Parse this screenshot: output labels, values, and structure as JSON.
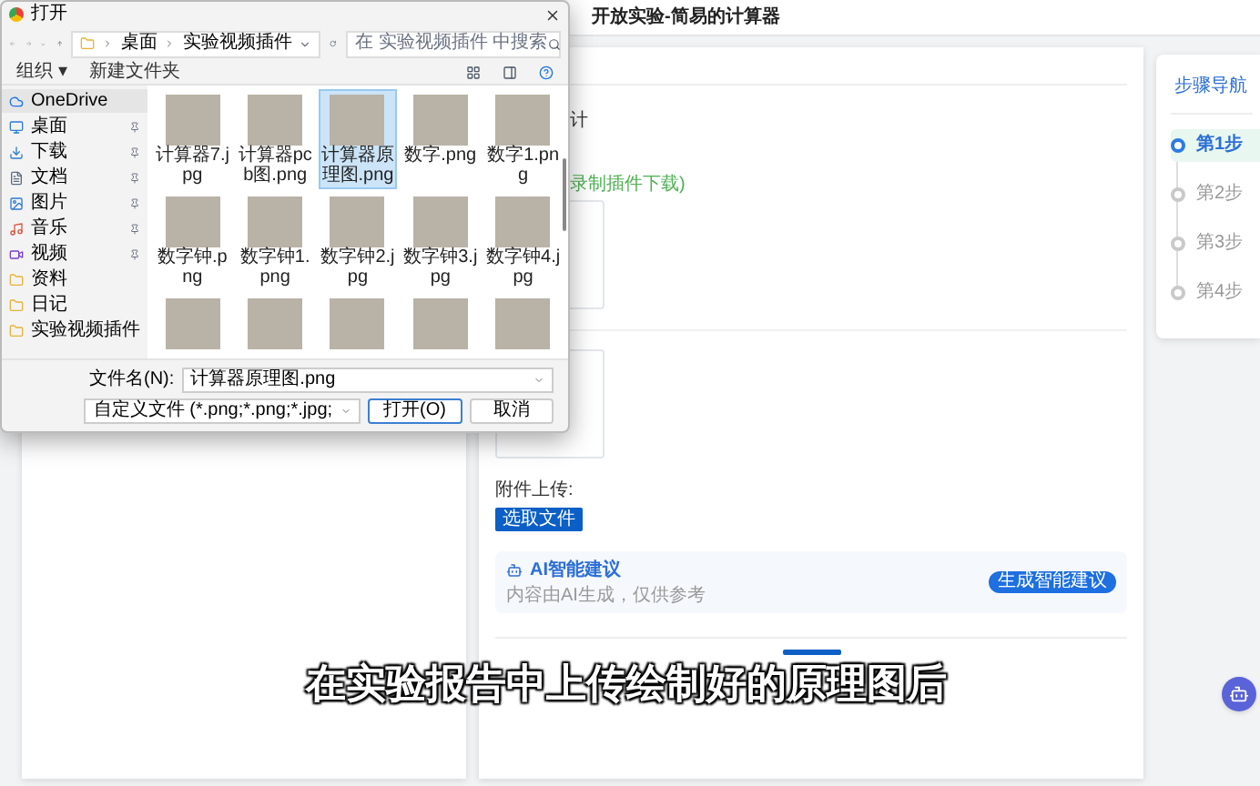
{
  "page": {
    "title": "开放实验-简易的计算器",
    "section_title": "计",
    "note": "录制插件下载)",
    "attachment_label": "附件上传:",
    "choose_file_button": "选取文件",
    "ai": {
      "title": "AI智能建议",
      "subtitle": "内容由AI生成，仅供参考",
      "button": "生成智能建议"
    }
  },
  "steps": {
    "title": "步骤导航",
    "items": [
      {
        "label": "第1步",
        "selected": true
      },
      {
        "label": "第2步",
        "selected": false
      },
      {
        "label": "第3步",
        "selected": false
      },
      {
        "label": "第4步",
        "selected": false
      }
    ]
  },
  "dialog": {
    "title": "打开",
    "breadcrumb": [
      "桌面",
      "实验视频插件"
    ],
    "search": {
      "placeholder": "在 实验视频插件 中搜索"
    },
    "organize": "组织 ▾",
    "new_folder": "新建文件夹",
    "sidebar": [
      {
        "label": "OneDrive",
        "kind": "cloud",
        "pinned": false,
        "selected": true
      },
      {
        "label": "桌面",
        "kind": "desktop",
        "pinned": true,
        "selected": false
      },
      {
        "label": "下载",
        "kind": "download",
        "pinned": true,
        "selected": false
      },
      {
        "label": "文档",
        "kind": "document",
        "pinned": true,
        "selected": false
      },
      {
        "label": "图片",
        "kind": "picture",
        "pinned": true,
        "selected": false
      },
      {
        "label": "音乐",
        "kind": "music",
        "pinned": true,
        "selected": false
      },
      {
        "label": "视频",
        "kind": "video",
        "pinned": true,
        "selected": false
      },
      {
        "label": "资料",
        "kind": "folder",
        "pinned": false,
        "selected": false
      },
      {
        "label": "日记",
        "kind": "folder",
        "pinned": false,
        "selected": false
      },
      {
        "label": "实验视频插件",
        "kind": "folder",
        "pinned": false,
        "selected": false
      }
    ],
    "files": [
      {
        "name": "计算器7.jpg",
        "selected": false
      },
      {
        "name": "计算器pcb图.png",
        "selected": false
      },
      {
        "name": "计算器原理图.png",
        "selected": true
      },
      {
        "name": "数字.png",
        "selected": false
      },
      {
        "name": "数字1.png",
        "selected": false
      },
      {
        "name": "数字钟.png",
        "selected": false
      },
      {
        "name": "数字钟1.png",
        "selected": false
      },
      {
        "name": "数字钟2.jpg",
        "selected": false
      },
      {
        "name": "数字钟3.jpg",
        "selected": false
      },
      {
        "name": "数字钟4.jpg",
        "selected": false
      },
      {
        "selected": false
      },
      {
        "selected": false
      },
      {
        "selected": false
      },
      {
        "selected": false
      },
      {
        "selected": false
      }
    ],
    "filename_label": "文件名(N):",
    "filename": "计算器原理图.png",
    "filetype": "自定义文件 (*.png;*.png;*.jpg;",
    "open_button": "打开(O)",
    "cancel_button": "取消"
  },
  "subtitle": "在实验报告中上传绘制好的原理图后"
}
